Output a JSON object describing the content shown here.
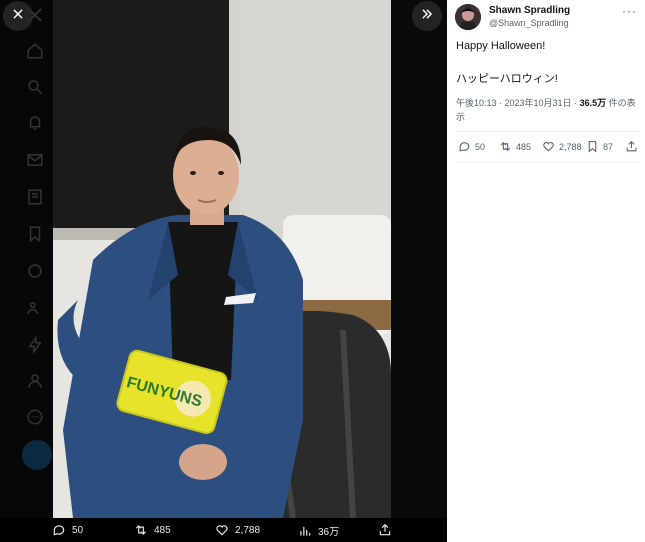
{
  "author": {
    "name": "Shawn Spradling",
    "handle": "@Shawn_Spradling"
  },
  "tweet": {
    "line1": "Happy Halloween!",
    "line2": "ハッピーハロウィン!",
    "time": "午後10:13 · 2023年10月31日 · ",
    "views": "36.5万",
    "views_suffix": " 件の表示"
  },
  "actions": {
    "replies": "50",
    "reposts": "485",
    "likes": "2,788",
    "bookmarks": "87"
  },
  "bottom_bar": {
    "replies": "50",
    "reposts": "485",
    "likes": "2,788",
    "views": "36万"
  },
  "photo": {
    "chips_label": "FUNYUNS"
  },
  "icons": {
    "close": "close-icon",
    "collapse": "double-chevron-right-icon",
    "more": "more-icon"
  }
}
